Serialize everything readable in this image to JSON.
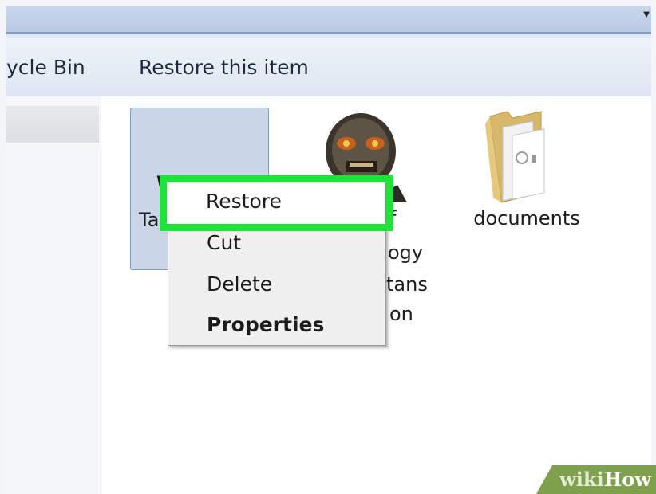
{
  "toolbar": {
    "back_label": "ycle Bin",
    "restore_item_label": "Restore this item"
  },
  "files": {
    "selected_item_label_fragment": "Ta",
    "selected_item_icon_fragment": "W",
    "zombie_item_label_lines": [
      "f",
      "ogy",
      "tans",
      "on"
    ],
    "folder_label": "documents"
  },
  "context_menu": {
    "items": [
      "Restore",
      "Cut",
      "Delete",
      "Properties"
    ]
  },
  "highlight": {
    "color": "#1fe33b"
  },
  "watermark": {
    "part1": "wiki",
    "part2": "How"
  }
}
